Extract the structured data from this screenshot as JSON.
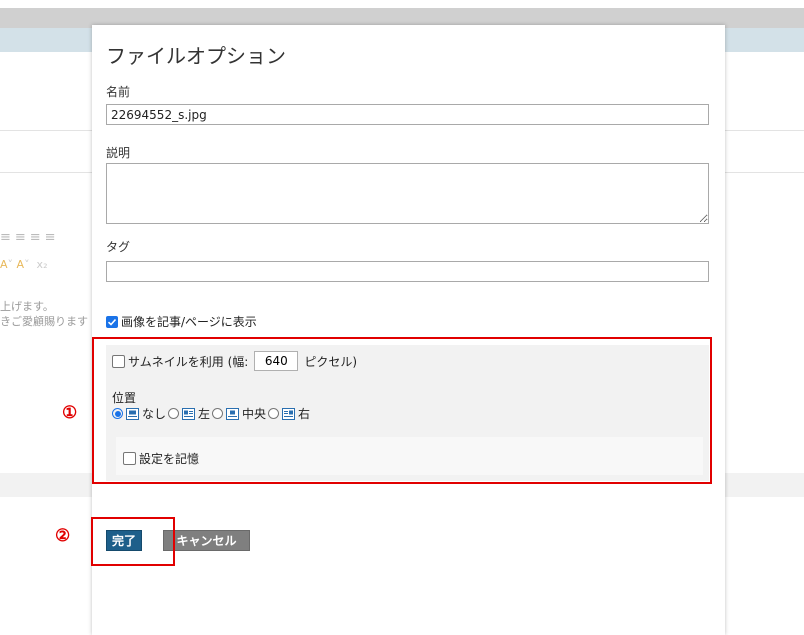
{
  "dialog": {
    "title": "ファイルオプション",
    "name_label": "名前",
    "name_value": "22694552_s.jpg",
    "description_label": "説明",
    "description_value": "",
    "tag_label": "タグ",
    "tag_value": "",
    "show_image_label": "画像を記事/ページに表示",
    "show_image_checked": true,
    "thumbnail_label": "サムネイルを利用 (幅:",
    "thumbnail_width": "640",
    "thumbnail_unit": "ピクセル)",
    "position_label": "位置",
    "positions": [
      {
        "label": "なし",
        "selected": true
      },
      {
        "label": "左",
        "selected": false
      },
      {
        "label": "中央",
        "selected": false
      },
      {
        "label": "右",
        "selected": false
      }
    ],
    "remember_label": "設定を記憶",
    "done_label": "完了",
    "cancel_label": "キャンセル"
  },
  "background": {
    "text_line1": "上げます。",
    "text_line2": "きご愛顧賜ります"
  },
  "annotations": {
    "marker1": "①",
    "marker2": "②"
  },
  "colors": {
    "accent": "#1a73e8",
    "done_button": "#1d5f8a",
    "cancel_button": "#7f7f7f",
    "highlight": "#e10000"
  }
}
